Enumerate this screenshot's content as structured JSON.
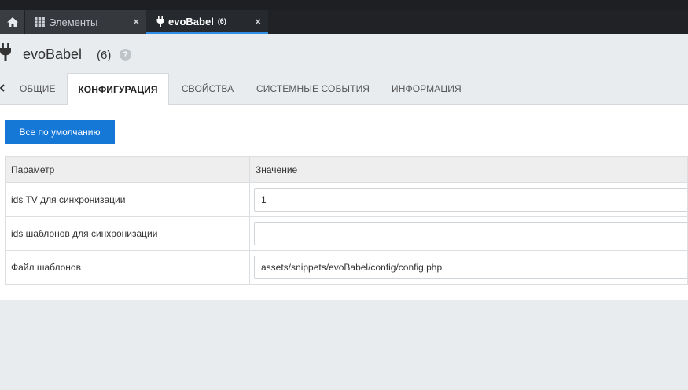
{
  "tabbar": {
    "home_icon": "home-icon",
    "tabs": [
      {
        "label": "Элементы",
        "icon": "grid-icon",
        "close": "×"
      },
      {
        "label": "evoBabel",
        "count": "(6)",
        "icon": "plug-icon",
        "close": "×"
      }
    ]
  },
  "header": {
    "title": "evoBabel",
    "count": "(6)",
    "help": "?"
  },
  "tabs": [
    {
      "label": "ОБЩИЕ"
    },
    {
      "label": "КОНФИГУРАЦИЯ"
    },
    {
      "label": "СВОЙСТВА"
    },
    {
      "label": "СИСТЕМНЫЕ СОБЫТИЯ"
    },
    {
      "label": "ИНФОРМАЦИЯ"
    }
  ],
  "active_tab": "КОНФИГУРАЦИЯ",
  "toolbar": {
    "defaults_label": "Все по умолчанию"
  },
  "config": {
    "headers": [
      "Параметр",
      "Значение"
    ],
    "rows": [
      {
        "param": "ids TV для синхронизации",
        "value": "1"
      },
      {
        "param": "ids шаблонов для синхронизации",
        "value": ""
      },
      {
        "param": "Файл шаблонов",
        "value": "assets/snippets/evoBabel/config/config.php"
      }
    ]
  },
  "colors": {
    "accent": "#1577d6",
    "tabbar_bg": "#202225",
    "active_tab_underline": "#2f8de4"
  }
}
